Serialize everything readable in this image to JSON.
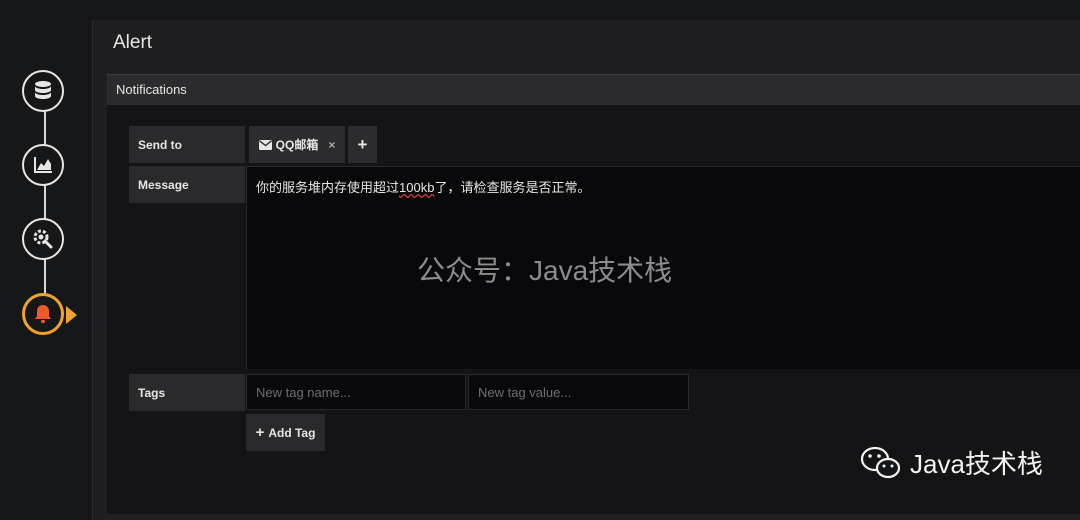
{
  "colors": {
    "background": "#161719",
    "panel": "#1f1f22",
    "accent": "#f0a32d",
    "bell": "#f05a28"
  },
  "steps": [
    {
      "icon": "database-icon"
    },
    {
      "icon": "chart-icon"
    },
    {
      "icon": "gear-icon"
    },
    {
      "icon": "bell-icon",
      "active": true
    }
  ],
  "panel": {
    "title": "Alert"
  },
  "notifications": {
    "header": "Notifications",
    "send_to_label": "Send to",
    "recipient": "QQ邮箱",
    "remove_symbol": "×",
    "add_symbol": "+",
    "message_label": "Message",
    "message_before": "你的服务堆内存使用超过",
    "message_underlined": "100kb",
    "message_after": "了，请检查服务是否正常。",
    "tags_label": "Tags",
    "tag_name_placeholder": "New tag name...",
    "tag_value_placeholder": "New tag value...",
    "add_tag_label": "Add Tag",
    "add_tag_symbol": "+"
  },
  "watermarks": {
    "center": "公众号：Java技术栈",
    "brand": "Java技术栈"
  }
}
